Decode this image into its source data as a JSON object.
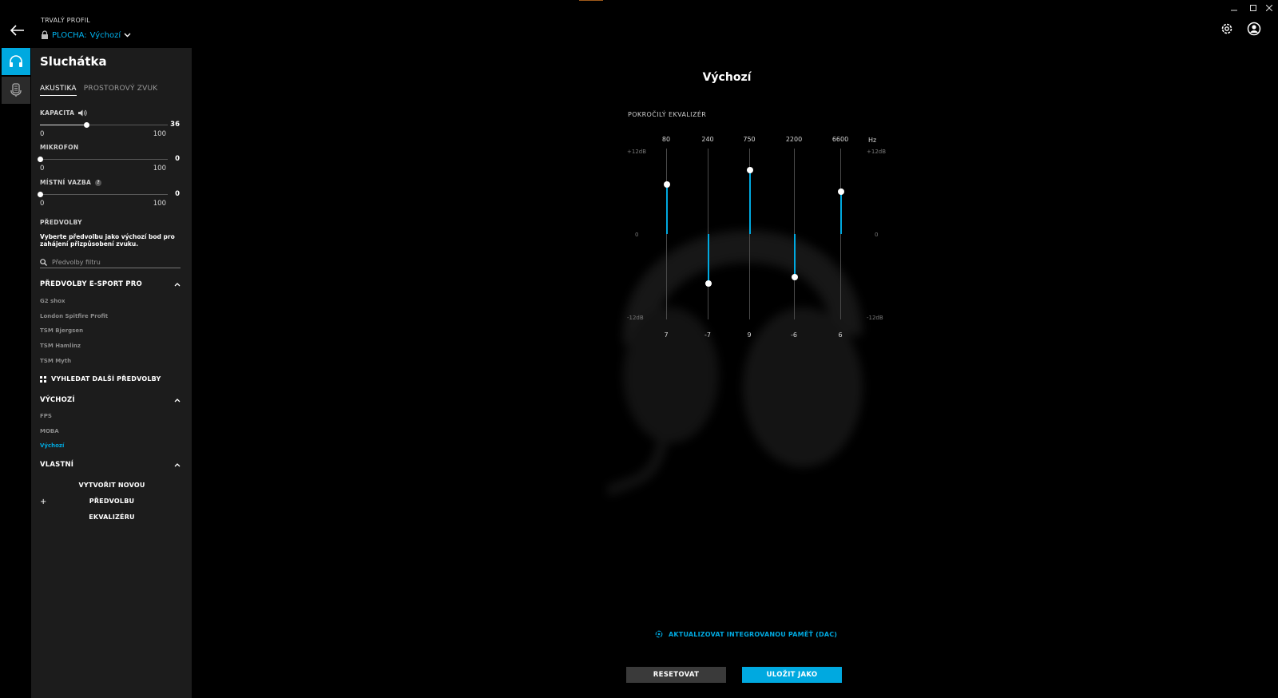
{
  "header": {
    "profile_caption": "TRVALÝ PROFIL",
    "profile_prefix": "PLOCHA:",
    "profile_value": "Výchozí"
  },
  "panel": {
    "title": "Sluchátka",
    "tabs": [
      "AKUSTIKA",
      "PROSTOROVÝ ZVUK"
    ],
    "active_tab": "AKUSTIKA",
    "sliders": [
      {
        "label": "KAPACITA",
        "value": "36",
        "min": "0",
        "max": "100",
        "level": 0.36
      },
      {
        "label": "MIKROFON",
        "value": "0",
        "min": "0",
        "max": "100",
        "level": 0
      },
      {
        "label": "MÍSTNÍ VAZBA",
        "value": "0",
        "min": "0",
        "max": "100",
        "level": 0
      }
    ],
    "presets_caption": "PŘEDVOLBY",
    "presets_description": "Vyberte předvolbu jako výchozí bod pro zahájení přizpůsobení zvuku.",
    "filter_placeholder": "Předvolby filtru",
    "groups": {
      "esport": {
        "title": "PŘEDVOLBY E-SPORT PRO",
        "items": [
          "G2 shox",
          "London Spitfire Profit",
          "TSM Bjergsen",
          "TSM Hamlinz",
          "TSM Myth"
        ]
      },
      "more_presets": "VYHLEDAT DALŠÍ PŘEDVOLBY",
      "default": {
        "title": "VÝCHOZÍ",
        "items": [
          "FPS",
          "MOBA",
          "Výchozí"
        ],
        "selected": "Výchozí"
      },
      "custom": {
        "title": "VLASTNÍ",
        "create_label_line1": "VYTVOŘIT NOVOU PŘEDVOLBU",
        "create_label_line2": "EKVALIZÉRU"
      }
    }
  },
  "main": {
    "title": "Výchozí",
    "eq_caption": "POKROČILÝ EKVALIZÉR",
    "db_top": "+12dB",
    "db_mid": "0",
    "db_bottom": "-12dB",
    "hz_label": "Hz",
    "dac_link": "AKTUALIZOVAT INTEGROVANOU PAMĚŤ (DAC)",
    "reset_button": "RESETOVAT",
    "save_button": "ULOŽIT JAKO"
  },
  "eq_bands": [
    {
      "freq": "80",
      "gain": 7,
      "gain_label": "7"
    },
    {
      "freq": "240",
      "gain": -7,
      "gain_label": "-7"
    },
    {
      "freq": "750",
      "gain": 9,
      "gain_label": "9"
    },
    {
      "freq": "2200",
      "gain": -6,
      "gain_label": "-6"
    },
    {
      "freq": "6600",
      "gain": 6,
      "gain_label": "6"
    }
  ],
  "colors": {
    "accent": "#00a9e0",
    "panel_bg": "#1c1c1c",
    "background": "#000000"
  }
}
